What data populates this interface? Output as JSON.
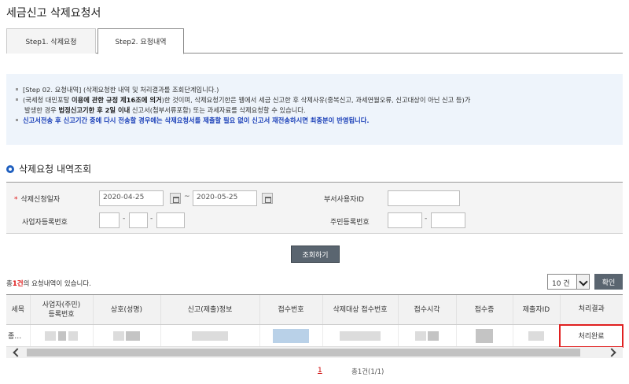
{
  "page": {
    "title": "세금신고 삭제요청서"
  },
  "tabs": [
    {
      "label": "Step1. 삭제요청",
      "active": false
    },
    {
      "label": "Step2. 요청내역",
      "active": true
    }
  ],
  "info": {
    "line1": "[Step 02. 요청내역] (삭제요청한 내역 및 처리결과를 조회단계입니다.)",
    "line2_pre": "(국세청 대민포탈 ",
    "line2_bold": "이용에 관한 규정 제16조에 의거",
    "line2_post": ")한 것이며, 삭제요청기한은 웹에서 세금 신고한 후 삭제사유(중복신고, 과세연월오류, 신고대상이 아닌 신고 등)가",
    "line3_pre": "발생한 경우 ",
    "line3_bold": "법정신고기한 후 2일 이내",
    "line3_post": " 신고서(첨부서류포함) 또는 과세자료를 삭제요청할 수 있습니다.",
    "line4": "신고서전송 후 신고기간 중에 다시 전송할 경우에는 삭제요청서를 제출할 필요 없이 신고서 재전송하시면 최종분이 반영됩니다."
  },
  "section": {
    "title": "삭제요청 내역조회"
  },
  "search": {
    "date_label": "삭제신청일자",
    "required_mark": "*",
    "date_from": "2020-04-25",
    "date_to": "2020-05-25",
    "tilde": "~",
    "dept_user_label": "부서사용자ID",
    "brn_label": "사업자등록번호",
    "rrn_label": "주민등록번호",
    "dash": "-",
    "button": "조회하기"
  },
  "results": {
    "count_pre": "총",
    "count_num": "1건",
    "count_post": "의 요청내역이 있습니다.",
    "page_size": "10 건",
    "confirm_button": "확인",
    "columns": [
      "세목",
      "사업자(주민)\n등록번호",
      "상호(성명)",
      "신고(제출)정보",
      "접수번호",
      "삭제대상 접수번호",
      "접수시각",
      "접수증",
      "제출자ID",
      "처리결과"
    ],
    "row": {
      "tax_item": "종…",
      "status": "처리완료"
    }
  },
  "pagination": {
    "current": "1",
    "total": "총1건(1/1)"
  },
  "colors": {
    "accent_blue": "#1f5fbf",
    "highlight_red": "#e02020",
    "info_bg": "#eef4fb"
  }
}
